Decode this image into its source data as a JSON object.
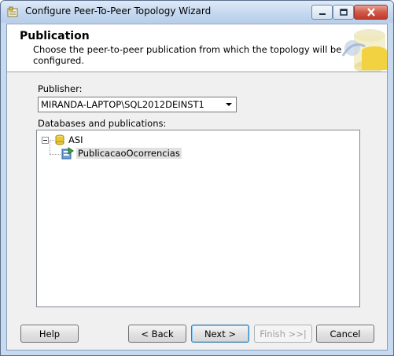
{
  "window": {
    "title": "Configure Peer-To-Peer Topology Wizard"
  },
  "header": {
    "title": "Publication",
    "description": "Choose the peer-to-peer publication from which the topology will be configured."
  },
  "publisher": {
    "label": "Publisher:",
    "value": "MIRANDA-LAPTOP\\SQL2012DEINST1"
  },
  "tree": {
    "label": "Databases and publications:",
    "database": "ASI",
    "publication": "PublicacaoOcorrencias"
  },
  "buttons": {
    "help": "Help",
    "back": "< Back",
    "next": "Next >",
    "finish": "Finish >>|",
    "cancel": "Cancel"
  },
  "colors": {
    "title_bar": "#c3d7ef",
    "close_button": "#c23a2b",
    "dialog_bg": "#f0f0f0",
    "header_bg": "#ffffff"
  }
}
